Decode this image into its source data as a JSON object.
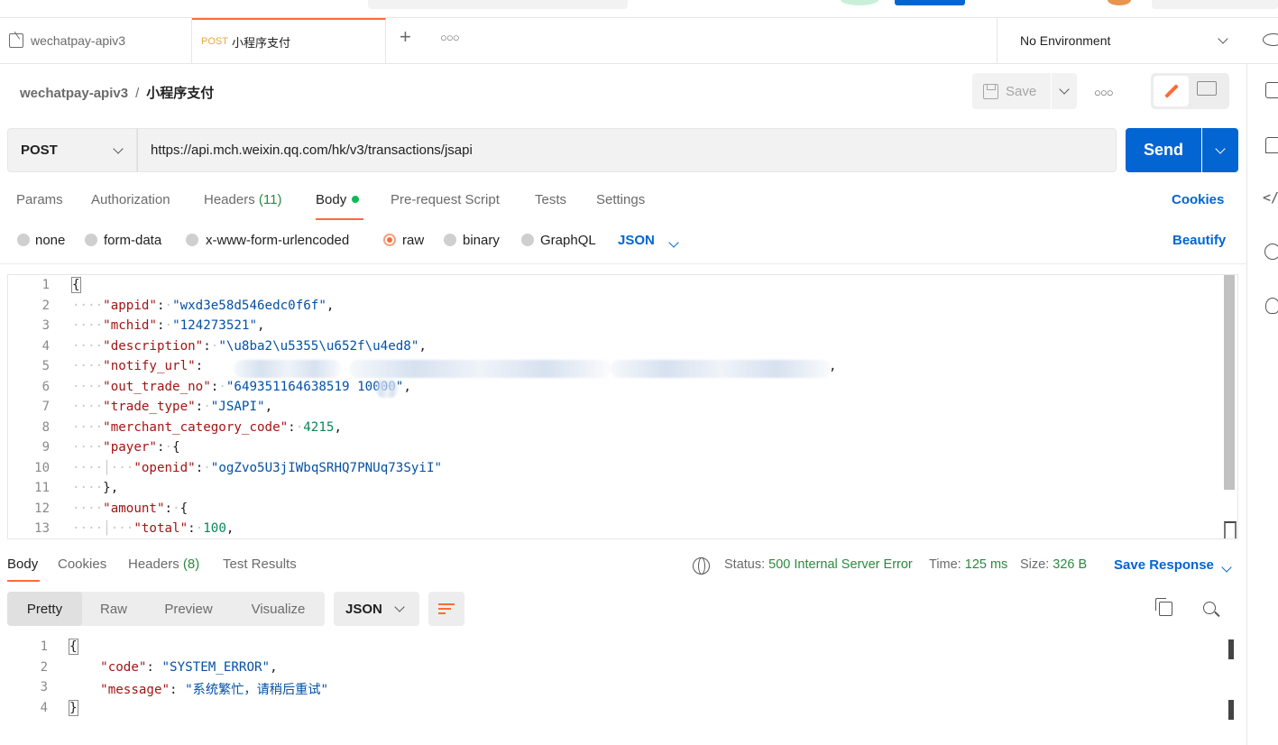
{
  "tabs": [
    {
      "label": "wechatpay-apiv3"
    },
    {
      "method": "POST",
      "label": "小程序支付"
    }
  ],
  "environment": {
    "label": "No Environment"
  },
  "breadcrumb": {
    "collection": "wechatpay-apiv3",
    "separator": "/",
    "request": "小程序支付"
  },
  "toolbar": {
    "save_label": "Save"
  },
  "request": {
    "method": "POST",
    "url": "https://api.mch.weixin.qq.com/hk/v3/transactions/jsapi",
    "send_label": "Send"
  },
  "request_tabs": {
    "params": "Params",
    "authorization": "Authorization",
    "headers": "Headers",
    "headers_count": "(11)",
    "body": "Body",
    "prerequest": "Pre-request Script",
    "tests": "Tests",
    "settings": "Settings",
    "cookies": "Cookies"
  },
  "body_types": {
    "none": "none",
    "form_data": "form-data",
    "urlencoded": "x-www-form-urlencoded",
    "raw": "raw",
    "binary": "binary",
    "graphql": "GraphQL",
    "format": "JSON",
    "beautify": "Beautify",
    "selected": "raw"
  },
  "editor": {
    "line_numbers": [
      "1",
      "2",
      "3",
      "4",
      "5",
      "6",
      "7",
      "8",
      "9",
      "10",
      "11",
      "12",
      "13"
    ],
    "lines": [
      {
        "indent": "",
        "parts": [
          {
            "t": "{",
            "c": ""
          }
        ]
      },
      {
        "indent": "····",
        "parts": [
          {
            "t": "\"appid\"",
            "c": "k"
          },
          {
            "t": ":·",
            "c": ""
          },
          {
            "t": "\"wxd3e58d546edc0f6f\"",
            "c": "s"
          },
          {
            "t": ",",
            "c": ""
          }
        ]
      },
      {
        "indent": "····",
        "parts": [
          {
            "t": "\"mchid\"",
            "c": "k"
          },
          {
            "t": ":·",
            "c": ""
          },
          {
            "t": "\"124273521\"",
            "c": "s"
          },
          {
            "t": ",",
            "c": ""
          }
        ]
      },
      {
        "indent": "····",
        "parts": [
          {
            "t": "\"description\"",
            "c": "k"
          },
          {
            "t": ":·",
            "c": ""
          },
          {
            "t": "\"\\u8ba2\\u5355\\u652f\\u4ed8\"",
            "c": "s"
          },
          {
            "t": ",",
            "c": ""
          }
        ]
      },
      {
        "indent": "····",
        "parts": [
          {
            "t": "\"notify_url\"",
            "c": "k"
          },
          {
            "t": ":",
            "c": ""
          }
        ]
      },
      {
        "indent": "····",
        "parts": [
          {
            "t": "\"out_trade_no\"",
            "c": "k"
          },
          {
            "t": ":·",
            "c": ""
          },
          {
            "t": "\"649351164638519 10000\"",
            "c": "s"
          },
          {
            "t": ",",
            "c": ""
          }
        ]
      },
      {
        "indent": "····",
        "parts": [
          {
            "t": "\"trade_type\"",
            "c": "k"
          },
          {
            "t": ":·",
            "c": ""
          },
          {
            "t": "\"JSAPI\"",
            "c": "s"
          },
          {
            "t": ",",
            "c": ""
          }
        ]
      },
      {
        "indent": "····",
        "parts": [
          {
            "t": "\"merchant_category_code\"",
            "c": "k"
          },
          {
            "t": ":·",
            "c": ""
          },
          {
            "t": "4215",
            "c": "n"
          },
          {
            "t": ",",
            "c": ""
          }
        ]
      },
      {
        "indent": "····",
        "parts": [
          {
            "t": "\"payer\"",
            "c": "k"
          },
          {
            "t": ":·{",
            "c": ""
          }
        ]
      },
      {
        "indent": "····│···",
        "parts": [
          {
            "t": "\"openid\"",
            "c": "k"
          },
          {
            "t": ":·",
            "c": ""
          },
          {
            "t": "\"ogZvo5U3jIWbqSRHQ7PNUq73SyiI\"",
            "c": "s"
          }
        ]
      },
      {
        "indent": "····",
        "parts": [
          {
            "t": "},",
            "c": ""
          }
        ]
      },
      {
        "indent": "····",
        "parts": [
          {
            "t": "\"amount\"",
            "c": "k"
          },
          {
            "t": ":·{",
            "c": ""
          }
        ]
      },
      {
        "indent": "····│···",
        "parts": [
          {
            "t": "\"total\"",
            "c": "k"
          },
          {
            "t": ":·",
            "c": ""
          },
          {
            "t": "100",
            "c": "n"
          },
          {
            "t": ",",
            "c": ""
          }
        ]
      }
    ]
  },
  "response_tabs": {
    "body": "Body",
    "cookies": "Cookies",
    "headers": "Headers",
    "headers_count": "(8)",
    "test_results": "Test Results"
  },
  "response_meta": {
    "status_label": "Status:",
    "status_value": "500 Internal Server Error",
    "time_label": "Time:",
    "time_value": "125 ms",
    "size_label": "Size:",
    "size_value": "326 B",
    "save_response": "Save Response"
  },
  "response_view": {
    "pretty": "Pretty",
    "raw": "Raw",
    "preview": "Preview",
    "visualize": "Visualize",
    "format": "JSON"
  },
  "response_body": {
    "line_numbers": [
      "1",
      "2",
      "3",
      "4"
    ],
    "lines": [
      {
        "parts": [
          {
            "t": "{",
            "c": ""
          }
        ]
      },
      {
        "parts": [
          {
            "t": "    ",
            "c": ""
          },
          {
            "t": "\"code\"",
            "c": "k"
          },
          {
            "t": ": ",
            "c": ""
          },
          {
            "t": "\"SYSTEM_ERROR\"",
            "c": "s"
          },
          {
            "t": ",",
            "c": ""
          }
        ]
      },
      {
        "parts": [
          {
            "t": "    ",
            "c": ""
          },
          {
            "t": "\"message\"",
            "c": "k"
          },
          {
            "t": ": ",
            "c": ""
          },
          {
            "t": "\"系统繁忙，请稍后重试\"",
            "c": "s"
          }
        ]
      },
      {
        "parts": [
          {
            "t": "}",
            "c": ""
          }
        ]
      }
    ]
  },
  "colors": {
    "accent": "#ff6c37",
    "primary": "#0265d2",
    "success": "#2b8a3e",
    "json_key": "#a31515",
    "json_string": "#0451a5",
    "json_number": "#098658"
  }
}
